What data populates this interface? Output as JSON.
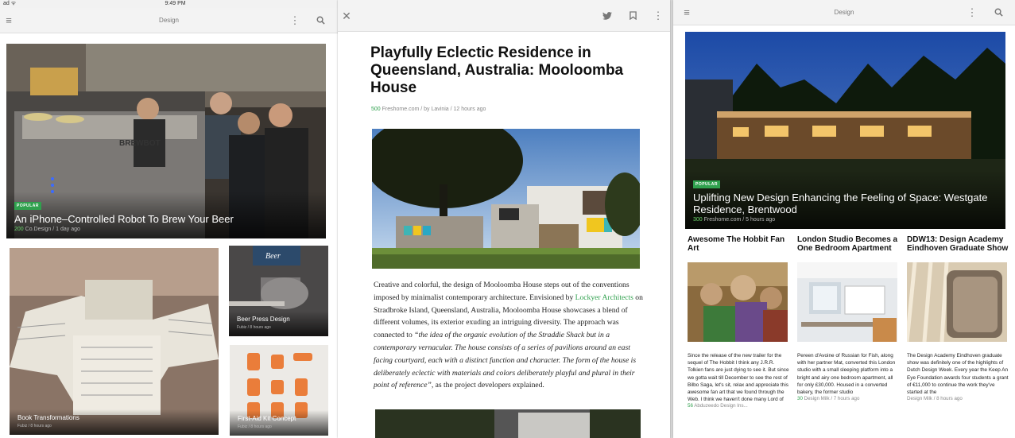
{
  "status": {
    "carrier": "ad ᯤ",
    "time": "9:49 PM"
  },
  "left": {
    "toolbar_title": "Design",
    "hero": {
      "badge": "POPULAR",
      "title": "An iPhone–Controlled Robot To Brew Your Beer",
      "count": "200",
      "meta": "Co.Design / 1 day ago",
      "logo": "BREWBOT"
    },
    "tiles": [
      {
        "title": "Book Transformations",
        "meta": "Fubiz / 8 hours ago"
      },
      {
        "title": "Beer Press Design",
        "meta": "Fubiz / 8 hours ago",
        "sign": "Beer"
      },
      {
        "title": "First-Aid Kit Concept",
        "meta": "Fubiz / 8 hours ago"
      }
    ]
  },
  "middle": {
    "title": "Playfully Eclectic Residence in Queensland, Australia: Mooloomba House",
    "count": "500",
    "meta": "Freshome.com / by Lavinia / 12 hours ago",
    "body": {
      "p1": "Creative and colorful, the design of Mooloomba House steps out of the conventions imposed by minimalist contemporary architecture. Envisioned by ",
      "link": "Lockyer Architects",
      "p2": " on Stradbroke Island, Queensland, Australia, Mooloomba House showcases a blend of different volumes, its exterior exuding an intriguing diversity. The approach was connected to ",
      "quote": "“the idea of the organic evolution of the Straddie Shack but in a contemporary vernacular. The house consists of a series of pavilions around an east facing courtyard, each with a distinct function and character.  The form of the house is deliberately eclectic with materials and colors deliberately playful and plural in their point of reference”",
      "p3": ", as the project developers explained."
    }
  },
  "right": {
    "toolbar_title": "Design",
    "hero": {
      "badge": "POPULAR",
      "title": "Uplifting New Design Enhancing the Feeling of Space: Westgate Residence, Brentwood",
      "count": "300",
      "meta": "Freshome.com / 5 hours ago"
    },
    "cols": [
      {
        "title": "Awesome The Hobbit Fan Art",
        "text": "Since the release of the new trailer for the sequel of The Hobbit I think any J.R.R. Tolkien fans are just dying to see it. But since we gotta wait till December to see the rest of Bilbo Saga, let's sit, relax and appreciate this awesome fan art that we found through the Web. I think we haven't done many Lord of",
        "count": "56",
        "meta": "Abduzeedo Design Ins..."
      },
      {
        "title": "London Studio Becomes a One Bedroom Apartment",
        "text": "Pereen d'Avoine of Russian for Fish, along with her partner Mat, converted this London studio with a small sleeping platform into a bright and airy one bedroom apartment, all for only £30,000. Housed in a converted bakery, the former studio",
        "count": "30",
        "meta": "Design Milk / 7 hours ago"
      },
      {
        "title": "DDW13: Design Academy Eindhoven Graduate Show",
        "text": "The Design Academy Eindhoven graduate show was definitely one of the highlights of Dutch Design Week. Every year the Keep An Eye Foundation awards four students a grant of €11,000 to continue the work they've started at the",
        "count": "",
        "meta": "Design Milk / 8 hours ago"
      }
    ]
  },
  "colors": {
    "accent": "#30a14e"
  }
}
